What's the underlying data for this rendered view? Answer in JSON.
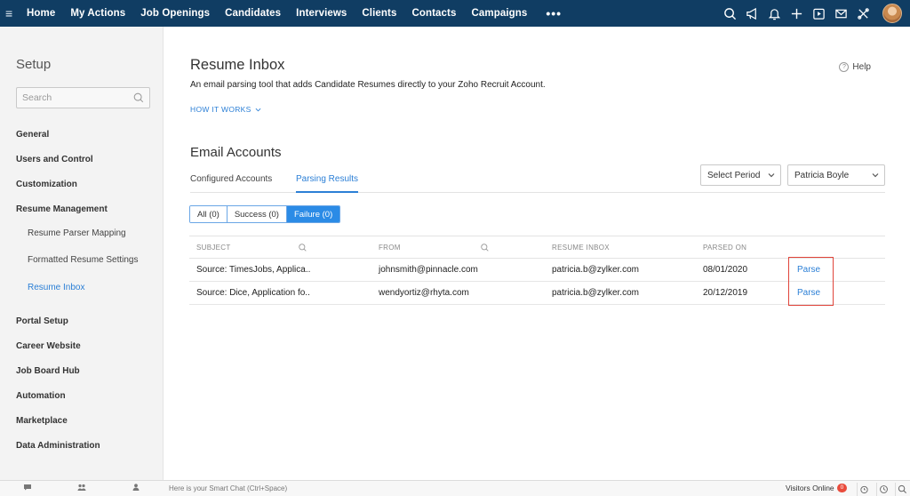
{
  "topnav": {
    "items": [
      "Home",
      "My Actions",
      "Job Openings",
      "Candidates",
      "Interviews",
      "Clients",
      "Contacts",
      "Campaigns"
    ],
    "more": "•••",
    "icons": [
      "search-icon",
      "megaphone-icon",
      "bell-icon",
      "plus-icon",
      "calendar-icon",
      "mail-icon",
      "tools-icon"
    ]
  },
  "sidebar": {
    "title": "Setup",
    "search_placeholder": "Search",
    "sections": [
      "General",
      "Users and Control",
      "Customization",
      "Resume Management"
    ],
    "subitems": [
      "Resume Parser Mapping",
      "Formatted Resume Settings",
      "Resume Inbox"
    ],
    "sections2": [
      "Portal Setup",
      "Career Website",
      "Job Board Hub",
      "Automation",
      "Marketplace",
      "Data Administration"
    ]
  },
  "main": {
    "title": "Resume Inbox",
    "subtitle": "An email parsing tool that adds Candidate Resumes directly to your Zoho Recruit Account.",
    "how_it_works": "HOW IT WORKS",
    "help": "Help",
    "section_title": "Email Accounts",
    "tabs": [
      "Configured Accounts",
      "Parsing Results"
    ],
    "period_select": "Select Period",
    "user_select": "Patricia Boyle",
    "filters": [
      "All (0)",
      "Success (0)",
      "Failure (0)"
    ],
    "columns": [
      "SUBJECT",
      "FROM",
      "RESUME INBOX",
      "PARSED ON"
    ],
    "rows": [
      {
        "subject": "Source: TimesJobs, Applica..",
        "from": "johnsmith@pinnacle.com",
        "inbox": "patricia.b@zylker.com",
        "parsed_on": "08/01/2020",
        "action": "Parse"
      },
      {
        "subject": "Source: Dice, Application fo..",
        "from": "wendyortiz@rhyta.com",
        "inbox": "patricia.b@zylker.com",
        "parsed_on": "20/12/2019",
        "action": "Parse"
      }
    ]
  },
  "bottombar": {
    "chat_placeholder": "Here is your Smart Chat (Ctrl+Space)",
    "visitors": "Visitors Online",
    "visitors_count": "0"
  },
  "colors": {
    "nav_bg": "#103d63",
    "accent": "#2b7fd6",
    "highlight": "#e0443a"
  }
}
